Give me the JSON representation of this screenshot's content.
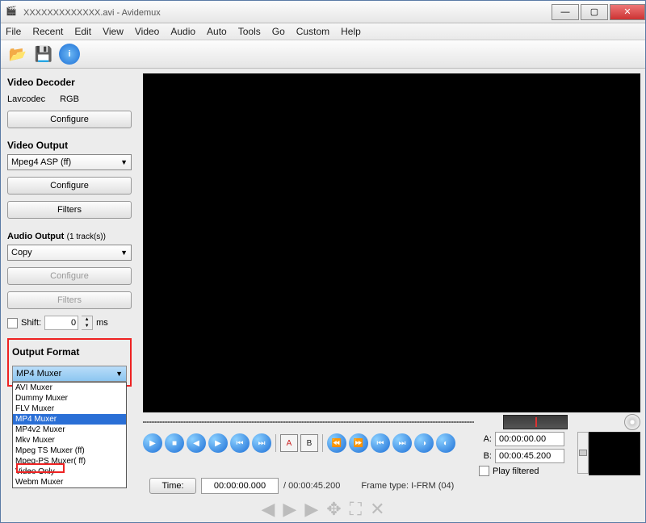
{
  "window": {
    "title_prefix": "XXXXXXXXXXXXX.avi",
    "app": " - Avidemux"
  },
  "winbtns": {
    "min": "—",
    "max": "▢",
    "close": "✕"
  },
  "menu": [
    "File",
    "Recent",
    "Edit",
    "View",
    "Video",
    "Audio",
    "Auto",
    "Tools",
    "Go",
    "Custom",
    "Help"
  ],
  "sidebar": {
    "decoder_title": "Video Decoder",
    "decoder_codec": "Lavcodec",
    "decoder_color": "RGB",
    "configure": "Configure",
    "video_output_title": "Video Output",
    "video_output_value": "Mpeg4 ASP (ff)",
    "filters": "Filters",
    "audio_output_title": "Audio Output",
    "audio_track_suffix": "(1 track(s))",
    "audio_output_value": "Copy",
    "shift_label": "Shift:",
    "shift_value": "0",
    "shift_unit": "ms",
    "output_format_title": "Output Format",
    "output_format_value": "MP4 Muxer",
    "format_options": [
      "AVI Muxer",
      "Dummy Muxer",
      "FLV Muxer",
      "MP4 Muxer",
      "MP4v2 Muxer",
      "Mkv Muxer",
      "Mpeg TS Muxer (ff)",
      "Mpeg-PS Muxer( ff)",
      "Video Only",
      "Webm Muxer"
    ],
    "format_highlight_index": 3
  },
  "bottom": {
    "time_label": "Time:",
    "time_value": "00:00:00.000",
    "duration_prefix": "/ ",
    "duration": "00:00:45.200",
    "frame_label": "Frame type:",
    "frame_value": "I-FRM (04)"
  },
  "ab": {
    "a_label": "A:",
    "a_value": "00:00:00.00",
    "b_label": "B:",
    "b_value": "00:00:45.200",
    "play_filtered": "Play filtered"
  }
}
